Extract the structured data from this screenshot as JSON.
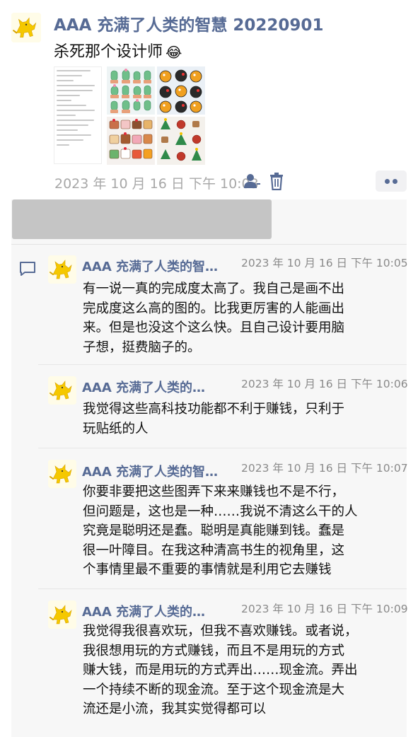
{
  "post": {
    "author": "AAA 充满了人类的智慧 20220901",
    "text": "杀死那个设计师",
    "emoji": "😂",
    "timestamp": "2023 年 10 月 16 日  下午 10:03",
    "icons": [
      "person-icon",
      "trash-icon",
      "more-dots-icon"
    ],
    "images": [
      "document-screenshot",
      "cactus-stickers",
      "bird-stickers",
      "cake-stickers",
      "christmas-stickers"
    ]
  },
  "comments": [
    {
      "author": "AAA 充满了人类的智…",
      "time": "2023 年 10 月 16 日  下午 10:05",
      "text": "有一说一真的完成度太高了。我自己是画不出\n完成度这么高的图的。比我更厉害的人能画出\n来。但是也没这个这么快。且自己设计要用脑\n子想，挺费脑子的。"
    },
    {
      "author": "AAA 充满了人类的…",
      "time": "2023 年 10 月 16 日  下午 10:06",
      "text": "我觉得这些高科技功能都不利于赚钱，只利于\n玩贴纸的人"
    },
    {
      "author": "AAA 充满了人类的智…",
      "time": "2023 年 10 月 16 日  下午 10:07",
      "text": "你要非要把这些图弄下来来赚钱也不是不行，\n但问题是，这也是一种……我说不清这么干的人\n究竟是聪明还是蠢。聪明是真能赚到钱。蠢是\n很一叶障目。在我这种清高书生的视角里，这\n个事情里最不重要的事情就是利用它去赚钱"
    },
    {
      "author": "AAA 充满了人类的…",
      "time": "2023 年 10 月 16 日  下午 10:09",
      "text": "我觉得我很喜欢玩，但我不喜欢赚钱。或者说，\n我很想用玩的方式赚钱，而且不是用玩的方式\n赚大钱，而是用玩的方式弄出……现金流。弄出\n一个持续不断的现金流。至于这个现金流是大\n流还是小流，我其实觉得都可以"
    }
  ],
  "colors": {
    "link_blue": "#576b95",
    "timestamp_gray": "#a8a8a8",
    "panel_bg": "#f7f7f7",
    "avatar_yellow": "#f5c800"
  }
}
